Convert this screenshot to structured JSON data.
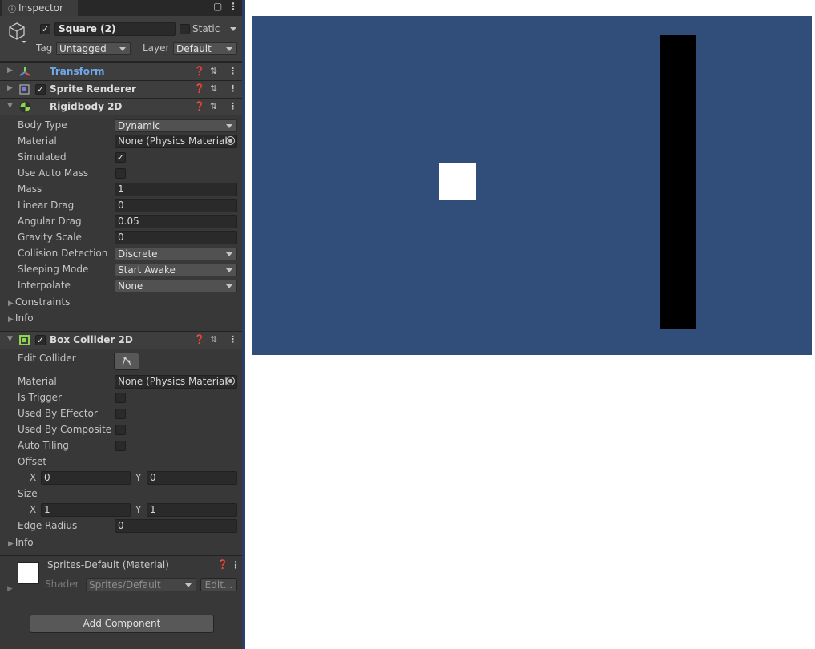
{
  "tab": {
    "title": "Inspector"
  },
  "header": {
    "active": true,
    "name": "Square (2)",
    "static_label": "Static",
    "tag_label": "Tag",
    "tag_value": "Untagged",
    "layer_label": "Layer",
    "layer_value": "Default"
  },
  "components": {
    "transform": {
      "title": "Transform"
    },
    "sprite_renderer": {
      "title": "Sprite Renderer"
    },
    "rigidbody": {
      "title": "Rigidbody 2D",
      "body_type": {
        "label": "Body Type",
        "value": "Dynamic"
      },
      "material": {
        "label": "Material",
        "value": "None (Physics Material"
      },
      "simulated": {
        "label": "Simulated",
        "checked": true
      },
      "use_auto_mass": {
        "label": "Use Auto Mass",
        "checked": false
      },
      "mass": {
        "label": "Mass",
        "value": "1"
      },
      "linear_drag": {
        "label": "Linear Drag",
        "value": "0"
      },
      "angular_drag": {
        "label": "Angular Drag",
        "value": "0.05"
      },
      "gravity_scale": {
        "label": "Gravity Scale",
        "value": "0"
      },
      "collision_detection": {
        "label": "Collision Detection",
        "value": "Discrete"
      },
      "sleeping_mode": {
        "label": "Sleeping Mode",
        "value": "Start Awake"
      },
      "interpolate": {
        "label": "Interpolate",
        "value": "None"
      },
      "constraints": "Constraints",
      "info": "Info"
    },
    "box_collider": {
      "title": "Box Collider 2D",
      "edit_collider": {
        "label": "Edit Collider"
      },
      "material": {
        "label": "Material",
        "value": "None (Physics Material"
      },
      "is_trigger": {
        "label": "Is Trigger",
        "checked": false
      },
      "used_by_effector": {
        "label": "Used By Effector",
        "checked": false
      },
      "used_by_composite": {
        "label": "Used By Composite",
        "checked": false
      },
      "auto_tiling": {
        "label": "Auto Tiling",
        "checked": false
      },
      "offset": {
        "label": "Offset",
        "x_label": "X",
        "x": "0",
        "y_label": "Y",
        "y": "0"
      },
      "size": {
        "label": "Size",
        "x_label": "X",
        "x": "1",
        "y_label": "Y",
        "y": "1"
      },
      "edge_radius": {
        "label": "Edge Radius",
        "value": "0"
      },
      "info": "Info"
    }
  },
  "material": {
    "name": "Sprites-Default (Material)",
    "shader_label": "Shader",
    "shader_value": "Sprites/Default",
    "edit_label": "Edit..."
  },
  "add_component": "Add Component",
  "colors": {
    "scene_background": "#314d79",
    "player": "#ffffff",
    "wall": "#000000",
    "transform_title": "#6fa8e8"
  }
}
